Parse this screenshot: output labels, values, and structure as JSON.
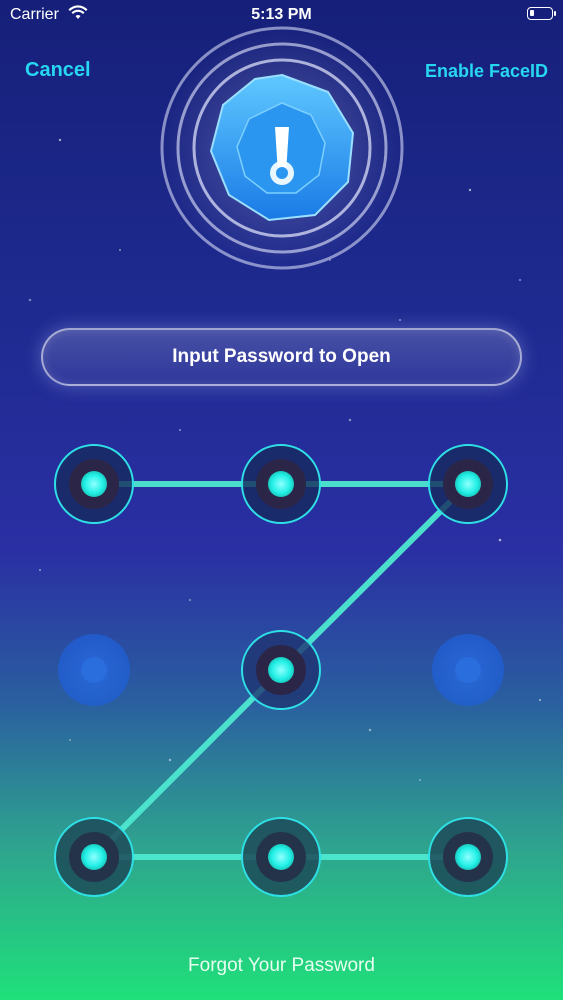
{
  "status_bar": {
    "carrier": "Carrier",
    "time": "5:13 PM"
  },
  "nav": {
    "cancel_label": "Cancel",
    "faceid_label": "Enable FaceID"
  },
  "prompt": {
    "text": "Input Password to Open"
  },
  "footer": {
    "forgot_label": "Forgot Your Password"
  },
  "pattern": {
    "selected_sequence": [
      1,
      2,
      3,
      5,
      7,
      8,
      9
    ],
    "inactive_nodes": [
      4,
      6
    ]
  },
  "colors": {
    "accent": "#27d6f0",
    "node_core": "#22f0e6",
    "path_line": "#4de8d0",
    "inactive_node": "#1f5fd6"
  },
  "icons": [
    "wifi-icon",
    "battery-icon",
    "keyhole-icon"
  ]
}
